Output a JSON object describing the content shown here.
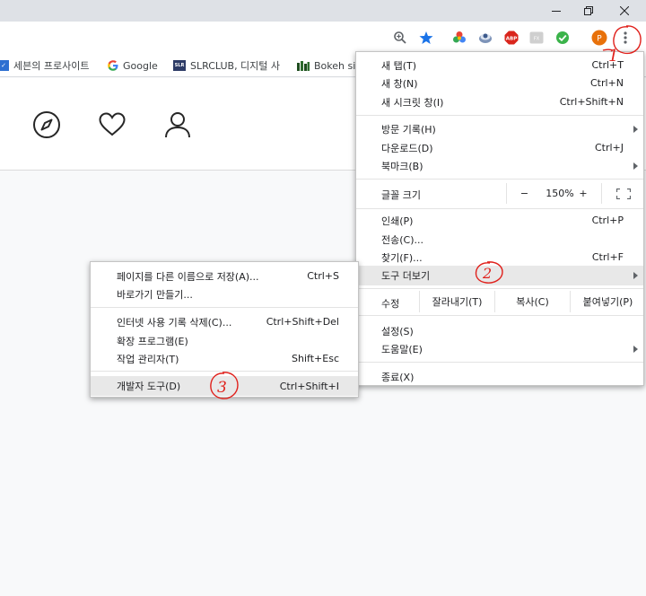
{
  "window": {
    "minimize": "minimize",
    "restore": "restore",
    "close": "close"
  },
  "toolbar": {
    "profile_initial": "P",
    "abp_label": "ABP",
    "gray_ext_label": "FX"
  },
  "bookmarks": [
    {
      "label": "세븐의 프로사이트"
    },
    {
      "label": "Google"
    },
    {
      "label": "SLRCLUB, 디지털 사"
    },
    {
      "label": "Bokeh sin"
    }
  ],
  "main_menu": {
    "new_tab": {
      "label": "새 탭(T)",
      "shortcut": "Ctrl+T"
    },
    "new_window": {
      "label": "새 창(N)",
      "shortcut": "Ctrl+N"
    },
    "incognito": {
      "label": "새 시크릿 창(I)",
      "shortcut": "Ctrl+Shift+N"
    },
    "history": {
      "label": "방문 기록(H)"
    },
    "downloads": {
      "label": "다운로드(D)",
      "shortcut": "Ctrl+J"
    },
    "bookmarks": {
      "label": "북마크(B)"
    },
    "zoom": {
      "label": "글꼴 크기",
      "minus": "−",
      "value": "150%",
      "plus": "+"
    },
    "print": {
      "label": "인쇄(P)",
      "shortcut": "Ctrl+P"
    },
    "cast": {
      "label": "전송(C)..."
    },
    "find": {
      "label": "찾기(F)...",
      "shortcut": "Ctrl+F"
    },
    "more_tools": {
      "label": "도구 더보기"
    },
    "edit": {
      "label": "수정",
      "cut": "잘라내기(T)",
      "copy": "복사(C)",
      "paste": "붙여넣기(P)"
    },
    "settings": {
      "label": "설정(S)"
    },
    "help": {
      "label": "도움말(E)"
    },
    "exit": {
      "label": "종료(X)"
    }
  },
  "sub_menu": {
    "save_page": {
      "label": "페이지를 다른 이름으로 저장(A)...",
      "shortcut": "Ctrl+S"
    },
    "create_shortcut": {
      "label": "바로가기 만들기..."
    },
    "clear_data": {
      "label": "인터넷 사용 기록 삭제(C)...",
      "shortcut": "Ctrl+Shift+Del"
    },
    "extensions": {
      "label": "확장 프로그램(E)"
    },
    "task_manager": {
      "label": "작업 관리자(T)",
      "shortcut": "Shift+Esc"
    },
    "dev_tools": {
      "label": "개발자 도구(D)",
      "shortcut": "Ctrl+Shift+I"
    }
  },
  "annotations": {
    "step1": "1",
    "step2": "2",
    "step3": "3"
  },
  "colors": {
    "annotation_red": "#e0201b",
    "star_blue": "#1a73e8",
    "profile_orange": "#e8710a"
  }
}
